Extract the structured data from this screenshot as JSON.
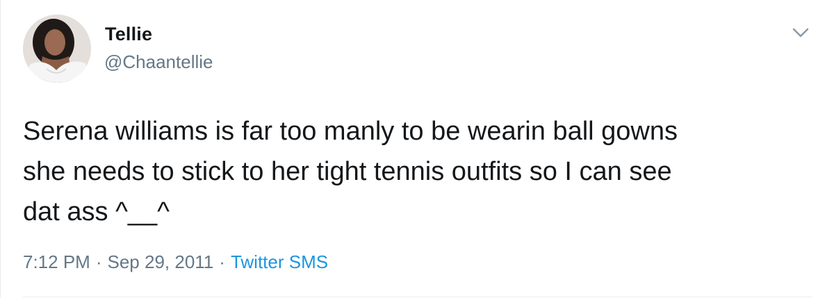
{
  "tweet": {
    "display_name": "Tellie",
    "handle": "@Chaantellie",
    "text": "Serena williams is far too manly to be wearin ball gowns\nshe needs to stick to her tight tennis outfits so I can see\ndat ass ^__^",
    "time": "7:12 PM",
    "separator": "·",
    "date": "Sep 29, 2011",
    "source": "Twitter SMS",
    "avatar_icon": "user-avatar",
    "menu_icon": "chevron-down-icon"
  },
  "colors": {
    "text": "#14171a",
    "secondary": "#657786",
    "link": "#1b95e0",
    "border": "#e6ecf0"
  }
}
